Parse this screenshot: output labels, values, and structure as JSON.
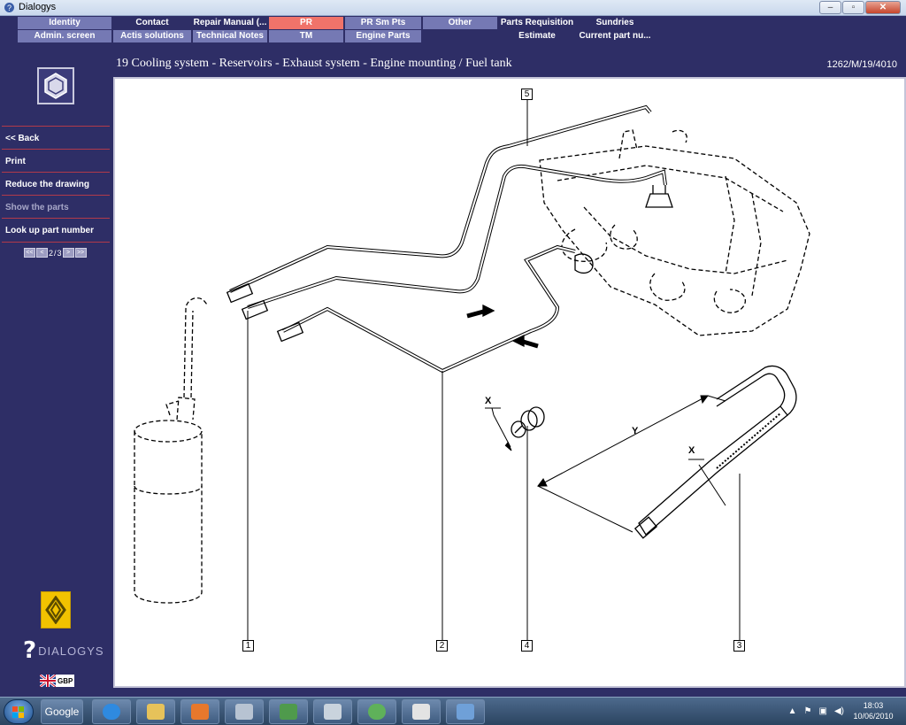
{
  "window": {
    "title": "Dialogys",
    "controls": {
      "minimize": "–",
      "restore": "▫",
      "close": "✕"
    }
  },
  "menu": {
    "row1": [
      "Identity",
      "Contact",
      "Repair Manual (...",
      "PR",
      "PR Sm Pts",
      "Other",
      "Parts Requisition",
      "Sundries"
    ],
    "row2": [
      "Admin. screen",
      "Actis solutions",
      "Technical Notes",
      "TM",
      "Engine Parts",
      "",
      "Estimate",
      "Current part nu..."
    ],
    "active_tab": "PR"
  },
  "sidebar": {
    "logo_icon": "hexagon-nut-icon",
    "items": [
      {
        "label": "<< Back",
        "enabled": true
      },
      {
        "label": "Print",
        "enabled": true
      },
      {
        "label": "Reduce the drawing",
        "enabled": true
      },
      {
        "label": "Show the parts",
        "enabled": false
      },
      {
        "label": "Look up part number",
        "enabled": true
      }
    ],
    "pager": {
      "first": "<<",
      "prev": "<",
      "current": "2",
      "separator": "/",
      "total": "3",
      "next": ">",
      "last": ">>"
    },
    "brand_text": "DIALOGYS",
    "currency": "GBP"
  },
  "main": {
    "heading": "19 Cooling system - Reservoirs - Exhaust system - Engine mounting / Fuel tank",
    "doc_ref": "1262/M/19/4010",
    "callouts": [
      "1",
      "2",
      "3",
      "4",
      "5"
    ],
    "dimension_labels": {
      "x_fitting": "X",
      "y_pipe": "Y",
      "x_pipe": "X"
    }
  },
  "taskbar": {
    "google_label": "Google",
    "apps": [
      "internet-explorer-icon",
      "folder-icon",
      "media-player-icon",
      "computer-icon",
      "network-icon",
      "scanner-icon",
      "messenger-icon",
      "java-icon",
      "paint-icon"
    ],
    "clock": {
      "time": "18:03",
      "date": "10/06/2010"
    }
  },
  "colors": {
    "background": "#2e2e66",
    "tab_light": "#7579b4",
    "tab_active": "#f0736a",
    "separator": "#b23a4a"
  }
}
